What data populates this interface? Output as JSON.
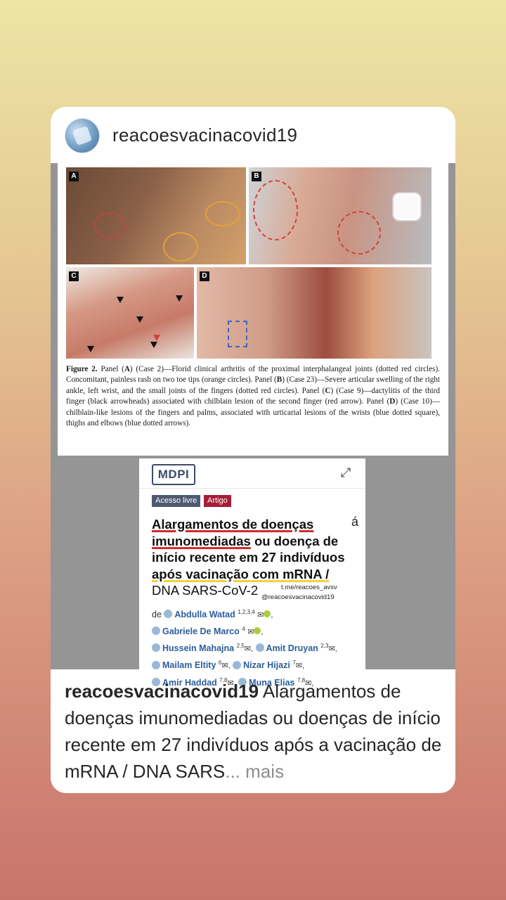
{
  "post": {
    "username": "reacoesvacinacovid19",
    "caption_user": "reacoesvacinacovid19",
    "caption_text": " Alargamentos de doenças imunomediadas ou doenças de início recente em 27 indivíduos após a vacinação de mRNA / DNA SARS",
    "caption_more": "... mais"
  },
  "figure": {
    "panel_letters": [
      "A",
      "B",
      "C",
      "D"
    ],
    "caption_parts": [
      {
        "b": "Figure 2.",
        "t": " Panel ("
      },
      {
        "b": "A",
        "t": ") (Case 2)—Florid clinical arthritis of the proximal interphalangeal joints (dotted red circles). Concomitant, painless rash on two toe tips (orange circles). Panel ("
      },
      {
        "b": "B",
        "t": ") (Case 23)—Severe articular swelling of the right ankle, left wrist, and the small joints of the fingers (dotted red circles). Panel ("
      },
      {
        "b": "C",
        "t": ") (Case 9)—dactylitis of the third finger (black arrowheads) associated with chilblain lesion of the second finger (red arrow). Panel ("
      },
      {
        "b": "D",
        "t": ") (Case 10)—chilblain-like lesions of the fingers and palms, associated with urticarial lesions of the wrists (blue dotted square), thighs and elbows (blue dotted arrows)."
      }
    ]
  },
  "article": {
    "logo": "MDPI",
    "tag_open": "Acesso livre",
    "tag_type": "Artigo",
    "accent": "á",
    "title_lines": [
      "Alargamentos de doenças",
      "imunomediadas",
      " ou doença de",
      "início recente em 27 indivíduos",
      "após vacinação com mRNA /",
      "DNA SARS-CoV-2"
    ],
    "watermark_1": "t.me/reacoes_avsv",
    "watermark_2": "@reacoesvacinacovid19",
    "authors_prefix": "de",
    "authors": [
      {
        "name": "Abdulla Watad",
        "sup": "1,2,3,4"
      },
      {
        "name": "Gabriele De Marco",
        "sup": "4"
      },
      {
        "name": "Hussein Mahajna",
        "sup": "2,5"
      },
      {
        "name": "Amit Druyan",
        "sup": "2,3"
      },
      {
        "name": "Mailam Eltity",
        "sup": "6"
      },
      {
        "name": "Nizar Hijazi",
        "sup": "7"
      },
      {
        "name": "Amir Haddad",
        "sup": "7,8"
      },
      {
        "name": "Muna Elias",
        "sup": "7,8"
      }
    ]
  },
  "icons": {
    "expand": "expand-icon",
    "mail": "mail-icon",
    "orcid": "orcid-icon",
    "profile": "author-profile-icon"
  }
}
